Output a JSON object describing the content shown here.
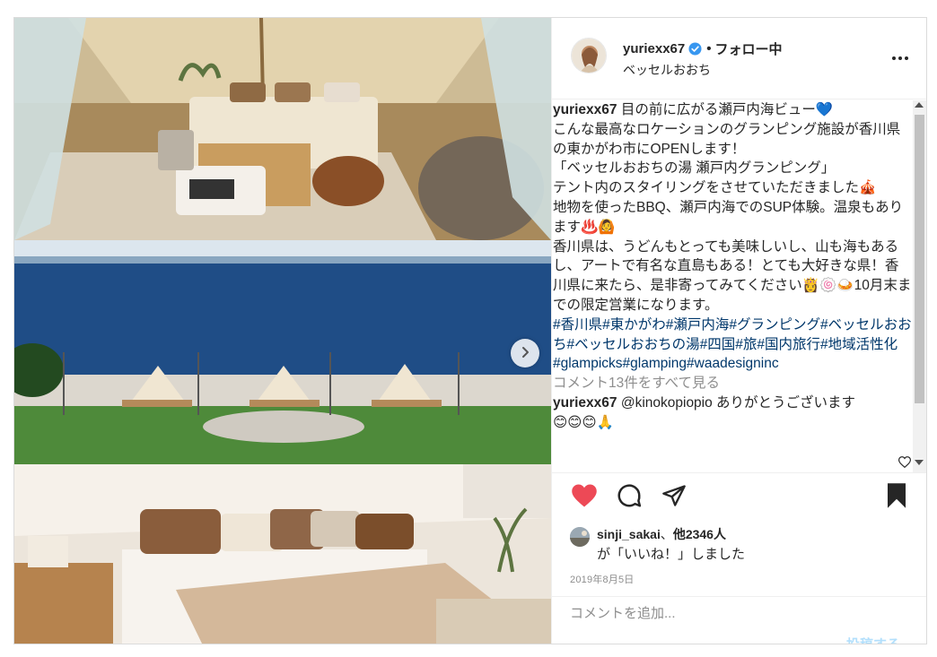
{
  "post": {
    "username": "yuriexx67",
    "separator": "•",
    "follow_status": "フォロー中",
    "location": "ベッセルおおち",
    "more_label": "•••"
  },
  "caption": {
    "username": "yuriexx67",
    "text": " 目の前に広がる瀬戸内海ビュー💙\nこんな最高なロケーションのグランピング施設が香川県の東かがわ市にOPENします！\n「ベッセルおおちの湯 瀬戸内グランピング」\nテント内のスタイリングをさせていただきました🎪\n地物を使ったBBQ、瀬戸内海でのSUP体験。温泉もあります♨️🙆\n香川県は、うどんもとっても美味しいし、山も海もあるし、アートで有名な直島もある！とても大好きな県！香川県に来たら、是非寄ってみてください👸🍥🍛10月末までの限定営業になります。\n",
    "hashtags": "#香川県#東かがわ#瀬戸内海#グランピング#ベッセルおおち#ベッセルおおちの湯#四国#旅#国内旅行#地域活性化\n#glampicks#glamping#waadesigninc",
    "view_all_comments": "コメント13件をすべて見る",
    "comment_user": "yuriexx67",
    "comment_text": " @kinokopiopio ありがとうございます",
    "comment_emojis": "😊😊😊🙏"
  },
  "likes": {
    "user": "sinji_sakai",
    "mid": "、",
    "others": "他2346人",
    "suffix": "が「いいね！」しました"
  },
  "date": "2019年8月5日",
  "comment_box": {
    "placeholder": "コメントを追加...",
    "post_label": "投稿する"
  },
  "colors": {
    "like_red": "#ed4956",
    "link_blue": "#00376b",
    "verified_blue": "#3897f0",
    "muted": "#8e8e8e"
  },
  "icons": {
    "like": "heart-filled-icon",
    "comment": "comment-icon",
    "share": "share-icon",
    "save": "bookmark-filled-icon",
    "more": "more-horizontal-icon",
    "next": "chevron-right-icon",
    "verified": "verified-badge-icon"
  }
}
